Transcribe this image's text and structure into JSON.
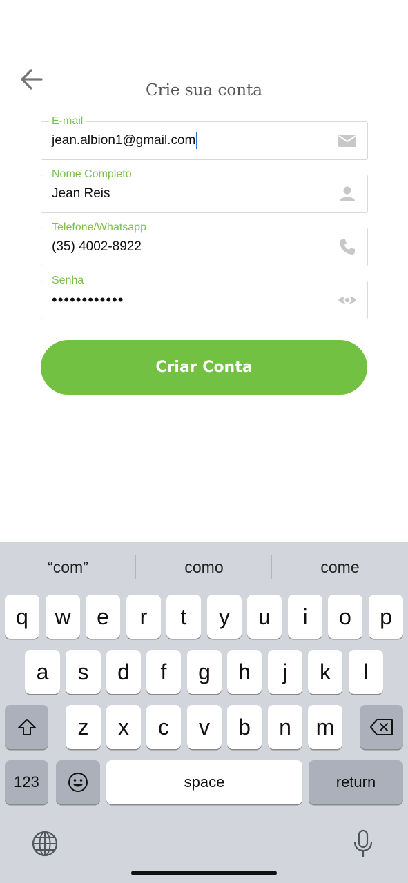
{
  "screen": {
    "title": "Crie sua conta"
  },
  "form": {
    "email": {
      "label": "E-mail",
      "value": "jean.albion1@gmail.com",
      "icon": "mail-icon"
    },
    "name": {
      "label": "Nome Completo",
      "value": "Jean Reis",
      "icon": "person-icon"
    },
    "phone": {
      "label": "Telefone/Whatsapp",
      "value": "(35) 4002-8922",
      "icon": "phone-icon"
    },
    "password": {
      "label": "Senha",
      "value": "••••••••••••",
      "icon": "eye-icon"
    },
    "submit_label": "Criar Conta"
  },
  "colors": {
    "accent": "#73c143",
    "label": "#7cc04b",
    "caret": "#2f6fe4",
    "keyboard_bg": "#d2d5db"
  },
  "keyboard": {
    "suggestions": [
      "“com”",
      "como",
      "come"
    ],
    "row1": [
      "q",
      "w",
      "e",
      "r",
      "t",
      "y",
      "u",
      "i",
      "o",
      "p"
    ],
    "row2": [
      "a",
      "s",
      "d",
      "f",
      "g",
      "h",
      "j",
      "k",
      "l"
    ],
    "row3": [
      "z",
      "x",
      "c",
      "v",
      "b",
      "n",
      "m"
    ],
    "numbers_label": "123",
    "space_label": "space",
    "return_label": "return"
  }
}
